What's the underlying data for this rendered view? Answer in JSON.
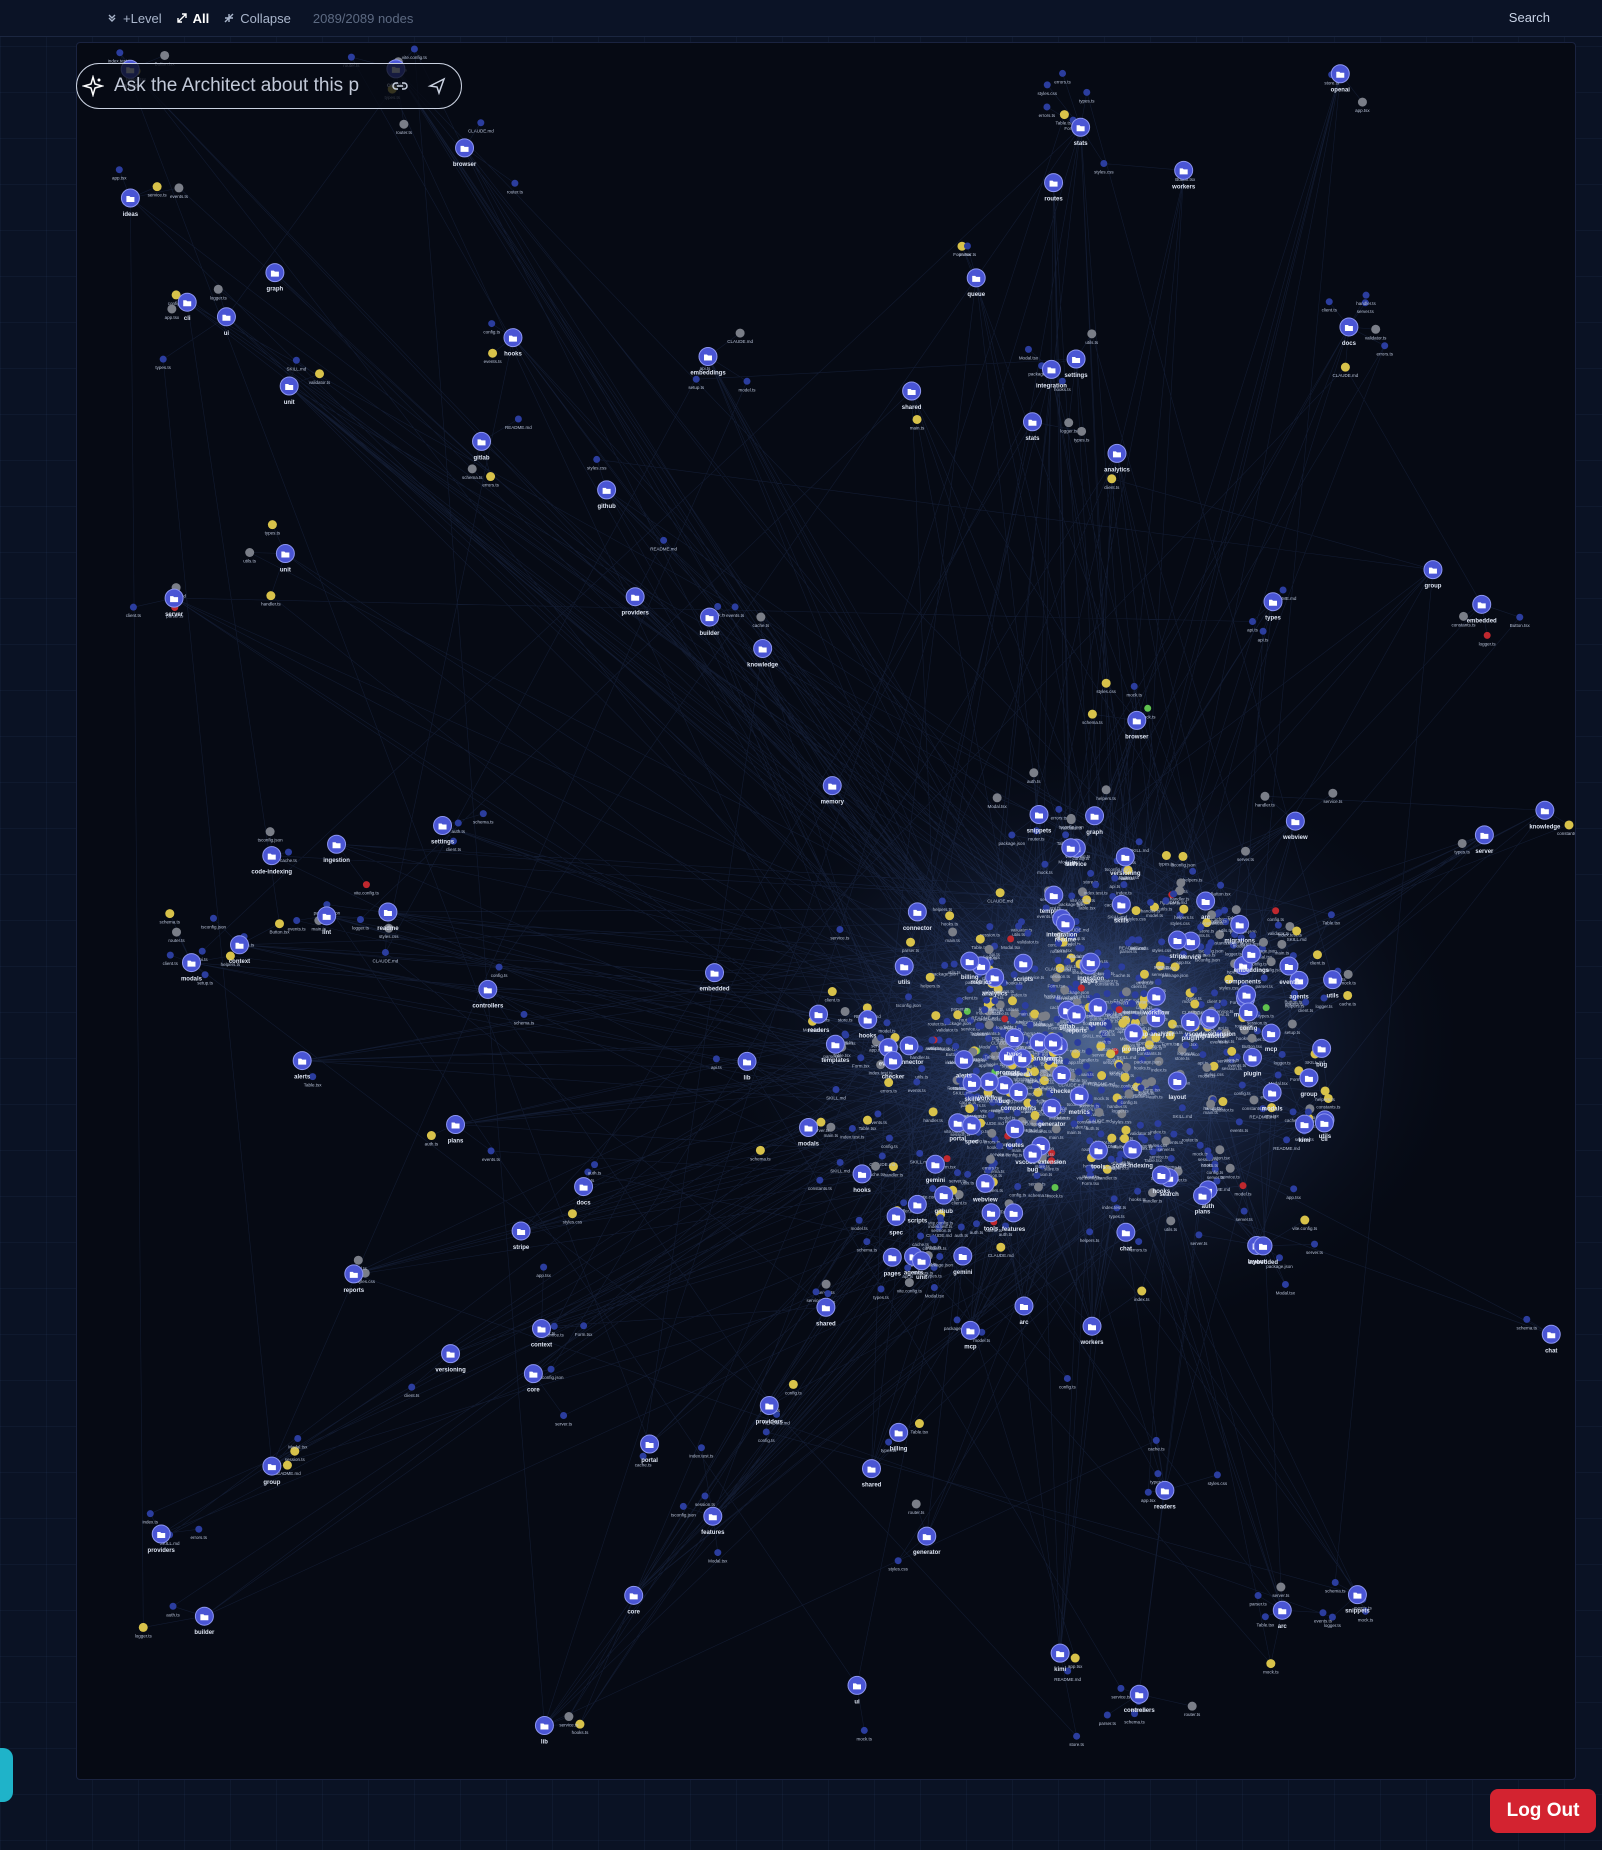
{
  "toolbar": {
    "level_label": "+Level",
    "all_label": "All",
    "collapse_label": "Collapse",
    "node_count": "2089/2089 nodes",
    "search_label": "Search"
  },
  "ask": {
    "placeholder": "Ask the Architect about this p"
  },
  "logout_label": "Log Out",
  "colors": {
    "background": "#0a1224",
    "canvas": "#060a14",
    "dir_node": "#4a55d4",
    "file_node": "#2b3d9e",
    "yellow_node": "#d8c24a",
    "red_node": "#c0282e",
    "green_node": "#5fc24e",
    "gray_node": "#7a7e88",
    "edge": "#3e5a9a",
    "logout": "#d32330",
    "side_tab": "#1fb3c9"
  },
  "graph": {
    "dir_labels": [
      "group",
      "embedded",
      "providers",
      "bug",
      "arc",
      "modals",
      "unit",
      "shared",
      "types",
      "utils",
      "service",
      "hooks",
      "components",
      "mcp",
      "server",
      "core",
      "lib",
      "integration",
      "webview",
      "pages",
      "readers",
      "config",
      "scripts",
      "tools",
      "plugin",
      "portal",
      "analytics",
      "routes",
      "chat",
      "memory",
      "features",
      "layout",
      "settings",
      "workflow",
      "builder",
      "checker",
      "controllers",
      "generator",
      "ui",
      "stats",
      "connector",
      "embeddings",
      "gap-analyzer",
      "versioning",
      "spec",
      "templates",
      "lint",
      "docs",
      "cli",
      "gitlab",
      "github",
      "graph",
      "skills",
      "gemini",
      "kimi",
      "openai",
      "prompts",
      "browser",
      "hooks",
      "ingestion",
      "migrations",
      "context",
      "knowledge",
      "agents",
      "workers",
      "stripe",
      "billing",
      "auth",
      "code-indexing",
      "reports",
      "events",
      "metrics",
      "alerts",
      "search",
      "queue",
      "vscode-extension",
      "readme",
      "plans",
      "ideas",
      "snippets"
    ],
    "file_labels": [
      "index.ts",
      "package.json",
      "README.md",
      "types.ts",
      "utils.ts",
      "config.ts",
      "index.test.ts",
      "schema.ts",
      "client.ts",
      "server.ts",
      "api.ts",
      "handler.ts",
      "router.ts",
      "hooks.ts",
      "store.ts",
      "service.ts",
      "model.ts",
      "constants.ts",
      "helpers.ts",
      "validator.ts",
      "parser.ts",
      "logger.ts",
      "cache.ts",
      "auth.ts",
      "session.ts",
      "events.ts",
      "errors.ts",
      "mock.ts",
      "setup.ts",
      "main.ts",
      "app.tsx",
      "Button.tsx",
      "Modal.tsx",
      "Table.tsx",
      "Form.tsx",
      "styles.css",
      "CLAUDE.md",
      "SKILL.md",
      "tsconfig.json",
      "vite.config.ts"
    ]
  }
}
